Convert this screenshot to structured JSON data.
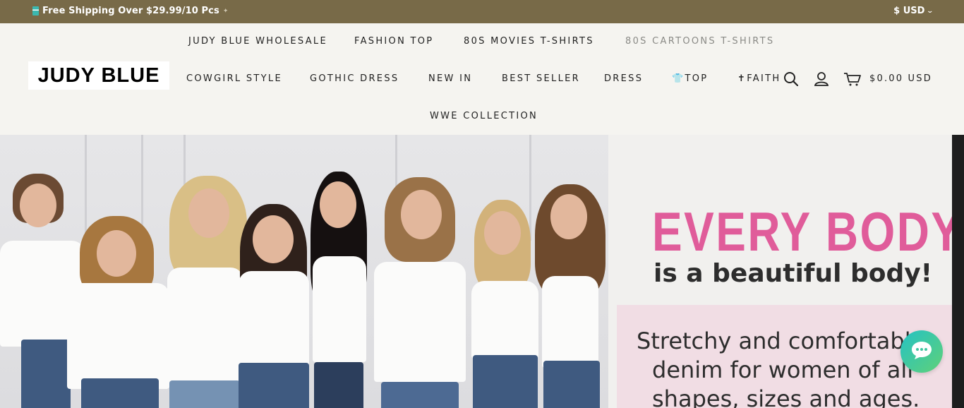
{
  "announcement": {
    "icon": "gift-icon",
    "text": "Free Shipping Over $29.99/10 Pcs",
    "currency_label": "$ USD"
  },
  "logo": {
    "text": "JUDY BLUE"
  },
  "nav": {
    "row1": [
      "JUDY BLUE WHOLESALE",
      "FASHION TOP",
      "80S MOVIES T-SHIRTS",
      "80S CARTOONS T-SHIRTS"
    ],
    "row2": [
      "COWGIRL STYLE",
      "GOTHIC DRESS",
      "NEW IN",
      "BEST SELLER",
      "DRESS",
      "👕TOP",
      "✝FAITH"
    ],
    "row3": [
      "WWE COLLECTION"
    ]
  },
  "header_icons": [
    "search-icon",
    "account-icon",
    "cart-icon"
  ],
  "cart": {
    "total": "$0.00 USD"
  },
  "hero": {
    "headline": "EVERY BODY",
    "subhead": "is a beautiful body!",
    "body_lines": [
      "Stretchy and comfortable",
      "denim for women of all",
      "shapes, sizes and ages."
    ],
    "colors": {
      "headline": "#e05c9a",
      "box": "#f1dde4",
      "announcement_bg": "#786a48"
    }
  },
  "chat": {
    "icon": "chat-icon"
  }
}
